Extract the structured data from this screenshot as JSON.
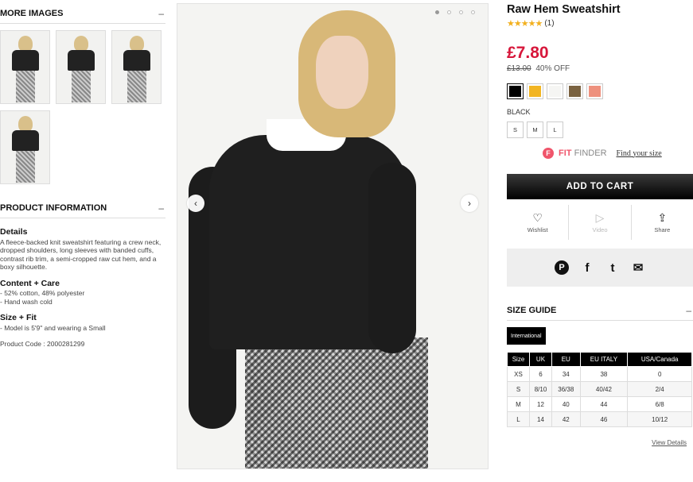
{
  "left": {
    "more_images": "MORE IMAGES",
    "more_toggle": "–",
    "product_info": "PRODUCT INFORMATION",
    "info_toggle": "–",
    "details_title": "Details",
    "details_text": "A fleece-backed knit sweatshirt featuring a crew neck, dropped shoulders, long sleeves with banded cuffs, contrast rib trim, a semi-cropped raw cut hem, and a boxy silhouette.",
    "content_title": "Content + Care",
    "content_1": "- 52% cotton, 48% polyester",
    "content_2": "- Hand wash cold",
    "size_title": "Size + Fit",
    "size_1": "- Model is 5'9\" and wearing a Small",
    "product_code": "Product Code : 2000281299"
  },
  "gallery": {
    "prev_icon": "‹",
    "next_icon": "›"
  },
  "product": {
    "title": "Raw Hem Sweatshirt",
    "stars": "★★★★★",
    "rating_count": "(1)",
    "price": "£7.80",
    "original_price": "£13.00",
    "discount": "40% OFF",
    "swatch_colors": [
      "#000000",
      "#f2b523",
      "#f5f5f3",
      "#7a6240",
      "#ee917e"
    ],
    "selected_color": "BLACK",
    "sizes": [
      "S",
      "M",
      "L"
    ],
    "fit_finder_logo": "F",
    "fit_finder_a": "FIT",
    "fit_finder_b": "FINDER",
    "fit_finder_link": "Find your size",
    "add_to_cart": "ADD TO CART",
    "actions": {
      "wishlist_icon": "♡",
      "wishlist": "Wishlist",
      "video_icon": "▷",
      "video": "Video",
      "share_icon": "⇪",
      "share": "Share"
    },
    "social": {
      "pinterest": "P",
      "facebook": "f",
      "twitter": "t",
      "email": "✉"
    }
  },
  "size_guide": {
    "title": "SIZE GUIDE",
    "toggle": "–",
    "tab": "International",
    "headers": [
      "Size",
      "UK",
      "EU",
      "EU ITALY",
      "USA/Canada"
    ],
    "rows": [
      [
        "XS",
        "6",
        "34",
        "38",
        "0"
      ],
      [
        "S",
        "8/10",
        "36/38",
        "40/42",
        "2/4"
      ],
      [
        "M",
        "12",
        "40",
        "44",
        "6/8"
      ],
      [
        "L",
        "14",
        "42",
        "46",
        "10/12"
      ]
    ],
    "view_details": "View Details"
  },
  "colors": {
    "price_red": "#d7173b",
    "fit_finder_pink": "#f0556b",
    "star_gold": "#f2b01e"
  }
}
